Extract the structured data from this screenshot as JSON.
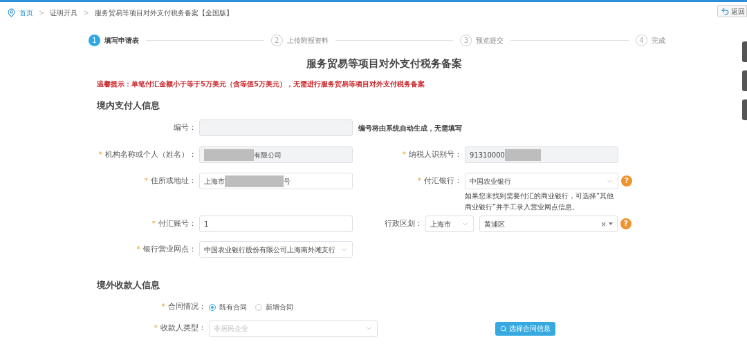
{
  "breadcrumb": [
    {
      "label": "首页",
      "link": true
    },
    {
      "label": "证明开具",
      "link": false
    },
    {
      "label": "服务贸易等项目对外支付税务备案【全国版】",
      "link": false
    }
  ],
  "breadcrumb_separator": ">",
  "back_button": {
    "label": "返回"
  },
  "steps": [
    {
      "number": "1",
      "label": "填写申请表",
      "selected": true
    },
    {
      "number": "2",
      "label": "上传附报资料",
      "selected": false
    },
    {
      "number": "3",
      "label": "预览提交",
      "selected": false
    },
    {
      "number": "4",
      "label": "完成",
      "selected": false
    }
  ],
  "title": "服务贸易等项目对外支付税务备案",
  "warning": "温馨提示：单笔付汇金额小于等于5万美元（含等值5万美元），无需进行服务贸易等项目对外支付税务备案",
  "payer": {
    "heading": "境内支付人信息",
    "serial": {
      "label": "编号：",
      "note": "编号将由系统自动生成，无需填写",
      "disabled": true
    },
    "org_name": {
      "label": "机构名称或个人（姓名）：",
      "required_mark": "*",
      "value": "有限公司",
      "redacted_before": true,
      "disabled": true
    },
    "tax_id": {
      "label": "纳税人识别号：",
      "required_mark": "*",
      "value": "91310000",
      "redacted_after": true,
      "disabled": true
    },
    "address": {
      "label": "住所或地址：",
      "required_mark": "*",
      "value_before": "上海市",
      "value_after": "号",
      "disabled": false
    },
    "bank": {
      "label": "付汇银行：",
      "required_mark": "*",
      "value": "中国农业银行",
      "help": "?",
      "hint": "如果您未找到需要付汇的商业银行，可选择“其他商业银行”并手工录入营业网点信息。"
    },
    "account": {
      "label": "付汇账号：",
      "required_mark": "*",
      "value": "1",
      "disabled": false
    },
    "region": {
      "label": "行政区划：",
      "city": "上海市",
      "district": "黄浦区",
      "clear": "×",
      "help": "?"
    },
    "branch": {
      "label": "银行营业网点：",
      "required_mark": "*",
      "value": "中国农业银行股份有限公司上海南外滩支行"
    }
  },
  "payee": {
    "heading": "境外收款人信息",
    "contract": {
      "label": "合同情况：",
      "required_mark": "*",
      "options": [
        {
          "label": "既有合同",
          "selected": true
        },
        {
          "label": "新增合同",
          "selected": false
        }
      ]
    },
    "payee_type": {
      "label": "收款人类型：",
      "required_mark": "*",
      "placeholder": "非居民企业"
    },
    "select_button": {
      "label": "选择合同信息"
    }
  }
}
